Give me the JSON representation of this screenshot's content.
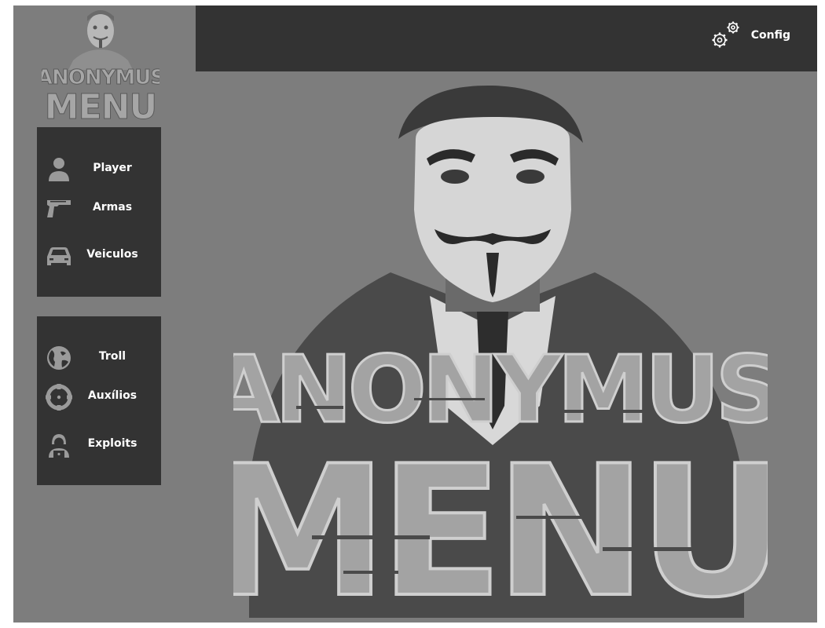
{
  "header": {
    "config_label": "Config",
    "config_icon": "gears-icon"
  },
  "brand": {
    "line1": "ANONYMUS",
    "line2": "MENU"
  },
  "menu_group_1": {
    "items": [
      {
        "label": "Player",
        "icon": "user-icon"
      },
      {
        "label": "Armas",
        "icon": "gun-icon"
      },
      {
        "label": "Veiculos",
        "icon": "car-icon"
      }
    ]
  },
  "menu_group_2": {
    "items": [
      {
        "label": "Troll",
        "icon": "globe-icon"
      },
      {
        "label": "Auxílios",
        "icon": "crosshair-icon"
      },
      {
        "label": "Exploits",
        "icon": "hacker-icon"
      }
    ]
  },
  "colors": {
    "background": "#7d7d7d",
    "panel": "#333333",
    "icon": "#9a9a9a",
    "text": "#ffffff"
  }
}
